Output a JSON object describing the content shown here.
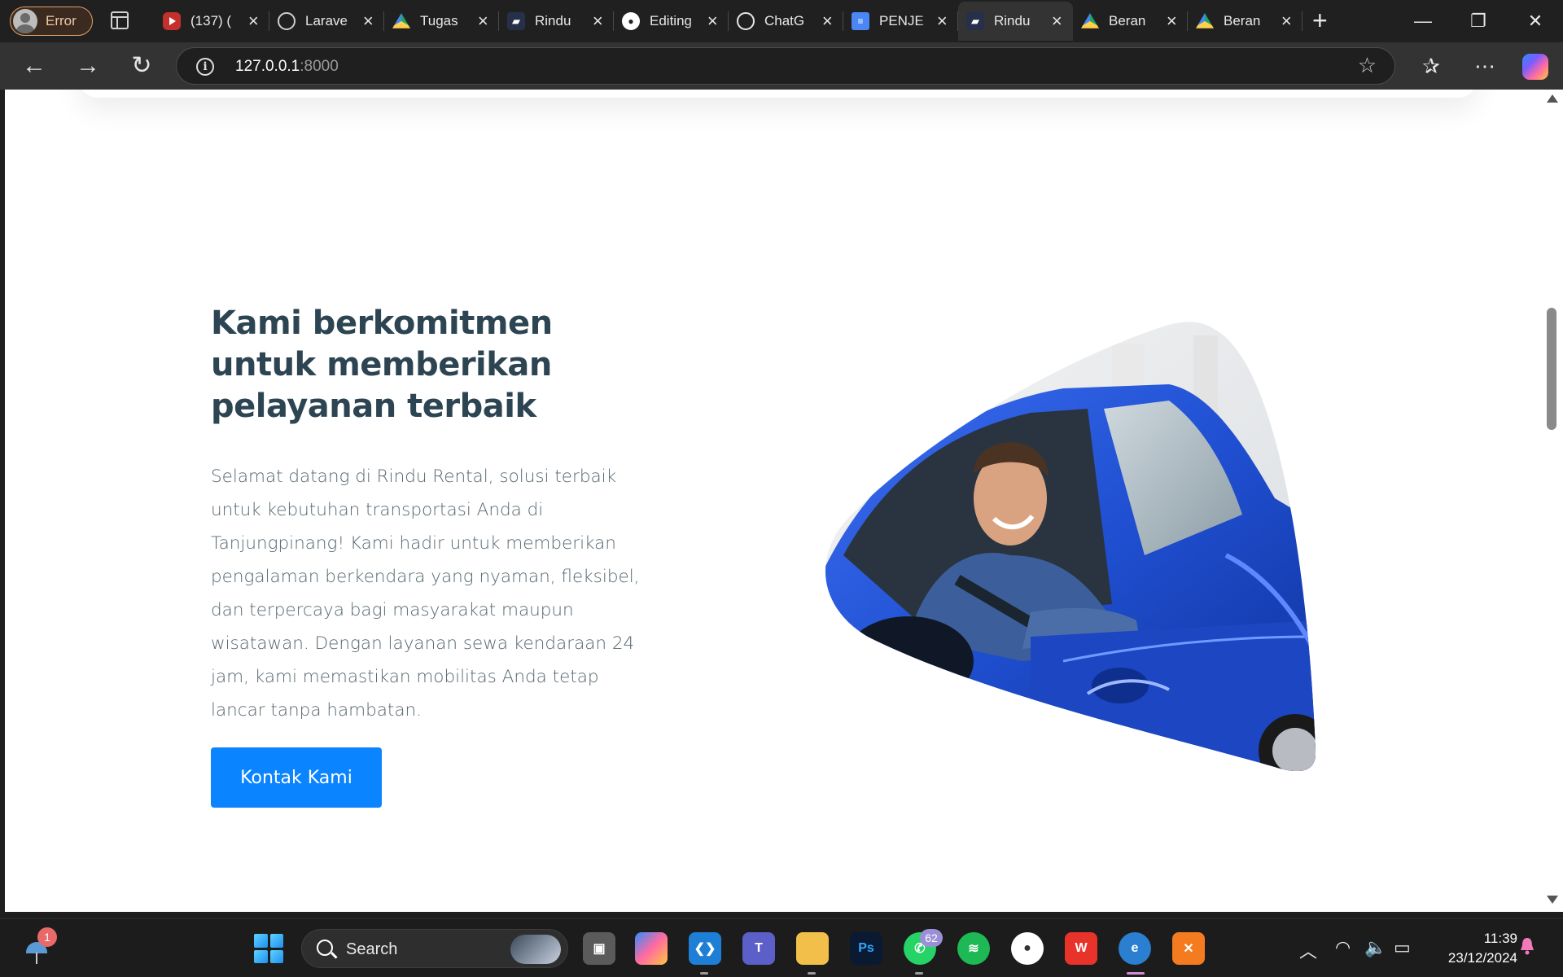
{
  "browser": {
    "profile_label": "Error",
    "tabs": [
      {
        "title": "(137) (",
        "icon": "youtube-icon"
      },
      {
        "title": "Larave",
        "icon": "globe-icon"
      },
      {
        "title": "Tugas",
        "icon": "google-drive-icon"
      },
      {
        "title": "Rindu",
        "icon": "car-site-icon"
      },
      {
        "title": "Editing",
        "icon": "github-icon"
      },
      {
        "title": "ChatG",
        "icon": "chatgpt-icon"
      },
      {
        "title": "PENJE",
        "icon": "google-docs-icon"
      },
      {
        "title": "Rindu",
        "icon": "car-site-icon",
        "active": true
      },
      {
        "title": "Beran",
        "icon": "google-drive-icon"
      },
      {
        "title": "Beran",
        "icon": "google-drive-icon"
      }
    ],
    "address": {
      "host": "127.0.0.1",
      "port": ":8000"
    }
  },
  "page": {
    "heading": "Kami berkomitmen untuk memberikan pelayanan terbaik",
    "paragraph": "Selamat datang di Rindu Rental, solusi terbaik untuk kebutuhan transportasi Anda di Tanjungpinang! Kami hadir untuk memberikan pengalaman berkendara yang nyaman, fleksibel, dan terpercaya bagi masyarakat maupun wisatawan. Dengan layanan sewa kendaraan 24 jam, kami memastikan mobilitas Anda tetap lancar tanpa hambatan.",
    "cta_label": "Kontak Kami",
    "image": "smiling-man-in-blue-car-photo"
  },
  "taskbar": {
    "weather_badge": "1",
    "search_label": "Search",
    "whatsapp_badge": "62",
    "time": "11:39",
    "date": "23/12/2024"
  },
  "colors": {
    "heading": "#2d4553",
    "body_text": "#56676f",
    "cta": "#0b84ff",
    "car_blue": "#1f4fd0"
  }
}
